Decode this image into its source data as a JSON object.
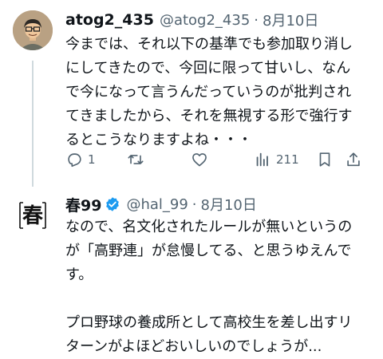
{
  "tweet1": {
    "display_name": "atog2_435",
    "handle": "@atog2_435",
    "separator": "·",
    "date": "8月10日",
    "lines": [
      "今までは、それ以下の基準でも参加取り消し",
      "にしてきたので、今回に限って甘いし、なん",
      "で今になって言うんだっていうのが批判され",
      "てきましたから、それを無視する形で強行す",
      "るとこうなりますよね・・・"
    ],
    "actions": {
      "reply_count": "1",
      "retweet_count": "",
      "like_count": "",
      "view_count": "211"
    }
  },
  "tweet2": {
    "display_name": "春99",
    "handle": "@hal_99",
    "separator": "·",
    "date": "8月10日",
    "avatar_text": "春",
    "lines_p1": [
      "なので、名文化されたルールが無いというの",
      "が「高野連」が怠慢してる、と思うゆえんで",
      "す。"
    ],
    "lines_p2": [
      "プロ野球の養成所として高校生を差し出すリ",
      "ターンがよほどおいしいのでしょうが..."
    ]
  },
  "colors": {
    "text": "#0f1419",
    "secondary": "#536471",
    "verified": "#1d9bf0",
    "thread_line": "#cfd9de"
  }
}
